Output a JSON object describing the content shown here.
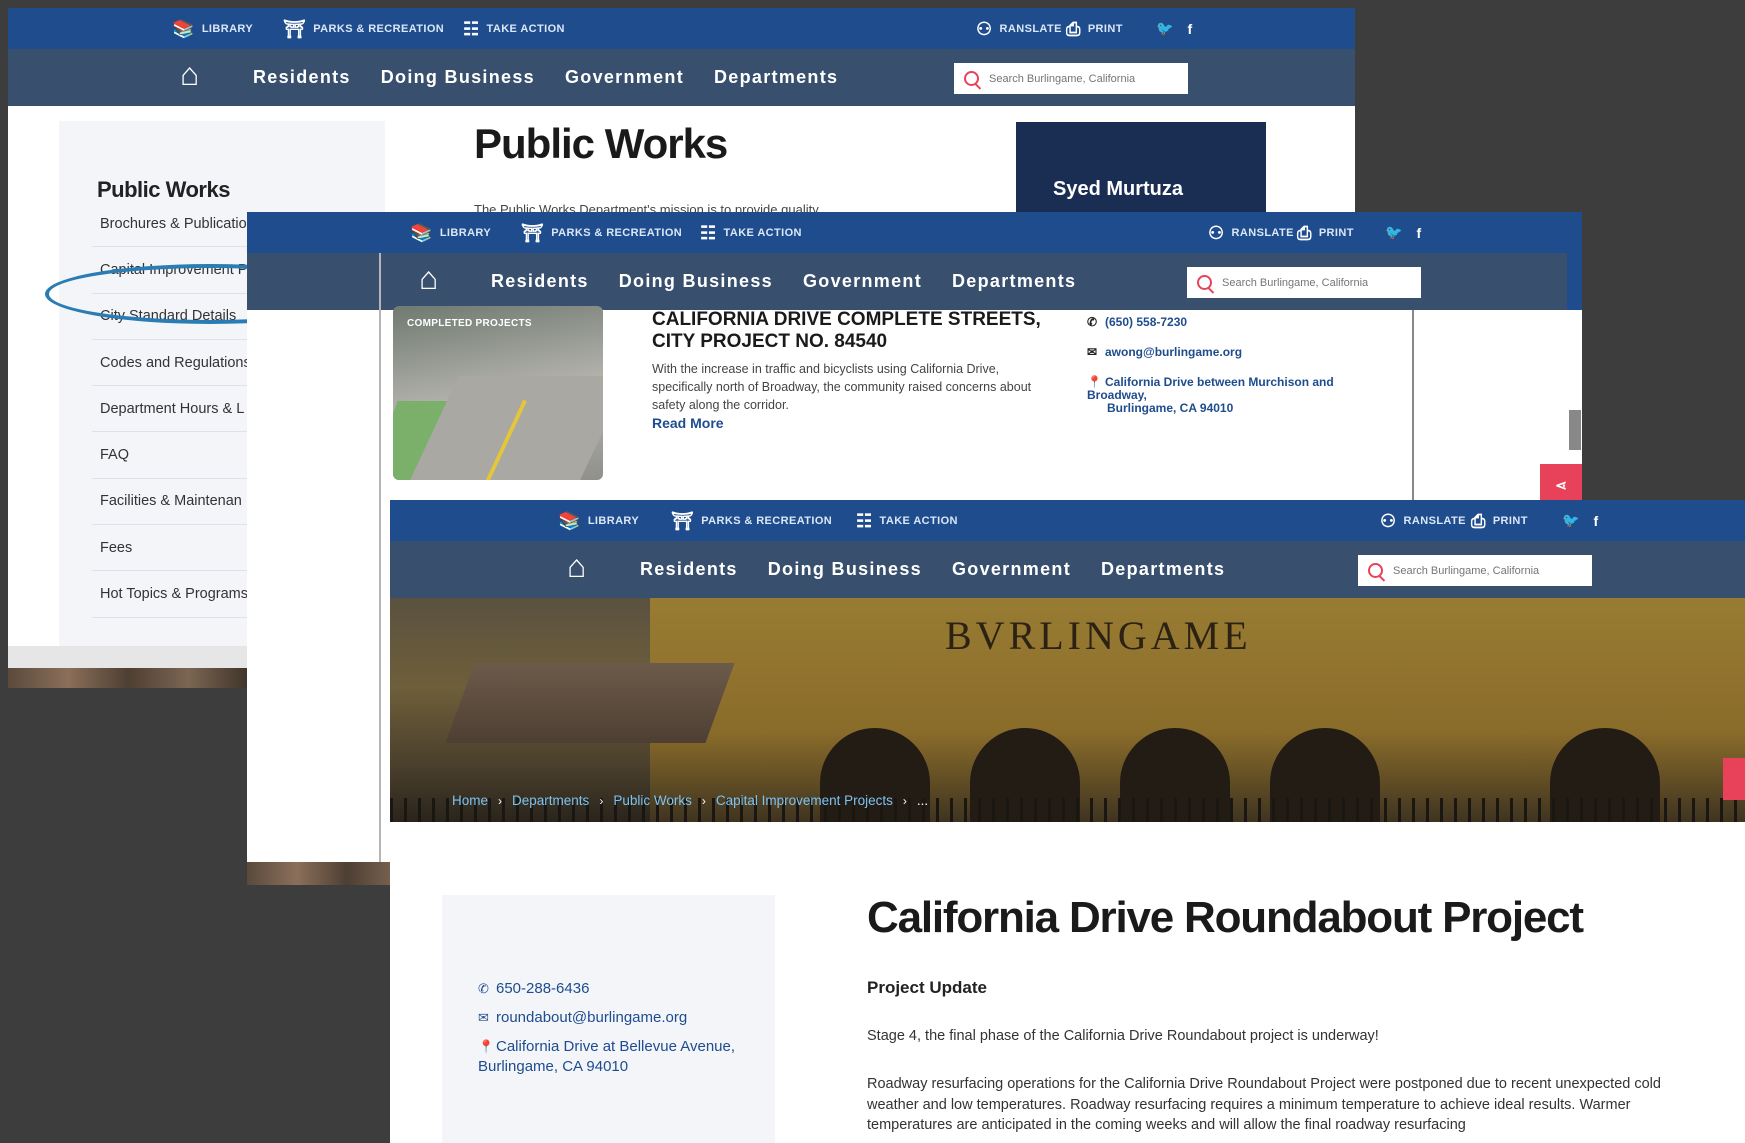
{
  "top_links": {
    "library": "LIBRARY",
    "parks": "PARKS & RECREATION",
    "take_action": "TAKE ACTION",
    "translate": "RANSLATE",
    "print": "PRINT"
  },
  "social": {
    "twitter": "🐦",
    "facebook": "f"
  },
  "nav": {
    "residents": "Residents",
    "doing_business": "Doing Business",
    "government": "Government",
    "departments": "Departments"
  },
  "search": {
    "placeholder": "Search Burlingame, California"
  },
  "window1": {
    "page_title": "Public Works",
    "mission": "The Public Works Department's mission is to provide quality",
    "sidebar_title": "Public Works",
    "sidebar_items": [
      "Brochures & Publicatio",
      "Capital Improvement P",
      "City Standard Details",
      "Codes and Regulations",
      "Department Hours & L",
      "FAQ",
      "Facilities & Maintenan",
      "Fees",
      "Hot Topics & Programs"
    ],
    "contact_name": "Syed Murtuza"
  },
  "window2": {
    "thumb_tag": "COMPLETED PROJECTS",
    "project_title": "CALIFORNIA DRIVE COMPLETE STREETS, CITY PROJECT NO. 84540",
    "project_desc": "With the increase in traffic and bicyclists using California Drive, specifically north of Broadway, the community raised concerns about safety along the corridor.",
    "read_more": "Read More",
    "phone": "(650) 558-7230",
    "email": "awong@burlingame.org",
    "location_line1": "California Drive between Murchison and Broadway,",
    "location_line2": "Burlingame, CA 94010"
  },
  "window3": {
    "hero_sign": "BVRLINGAME",
    "breadcrumbs": [
      "Home",
      "Departments",
      "Public Works",
      "Capital Improvement Projects",
      "..."
    ],
    "phone": "650-288-6436",
    "email": "roundabout@burlingame.org",
    "location_line1": "California Drive at Bellevue Avenue,",
    "location_line2": "Burlingame, CA 94010",
    "title": "California Drive Roundabout Project",
    "subtitle": "Project Update",
    "para1": "Stage 4, the final phase of the California Drive Roundabout project is underway!",
    "para2": "Roadway resurfacing operations for the California Drive Roundabout Project were postponed due to recent unexpected cold weather and low temperatures. Roadway resurfacing requires a minimum temperature to achieve ideal results. Warmer temperatures are anticipated in the coming weeks and will allow the final roadway resurfacing"
  },
  "colors": {
    "topbar": "#1e4c8d",
    "navbar": "#38506e",
    "accent": "#e8425a",
    "link": "#1e4c8d",
    "highlight_oval": "#2a7cb4"
  }
}
